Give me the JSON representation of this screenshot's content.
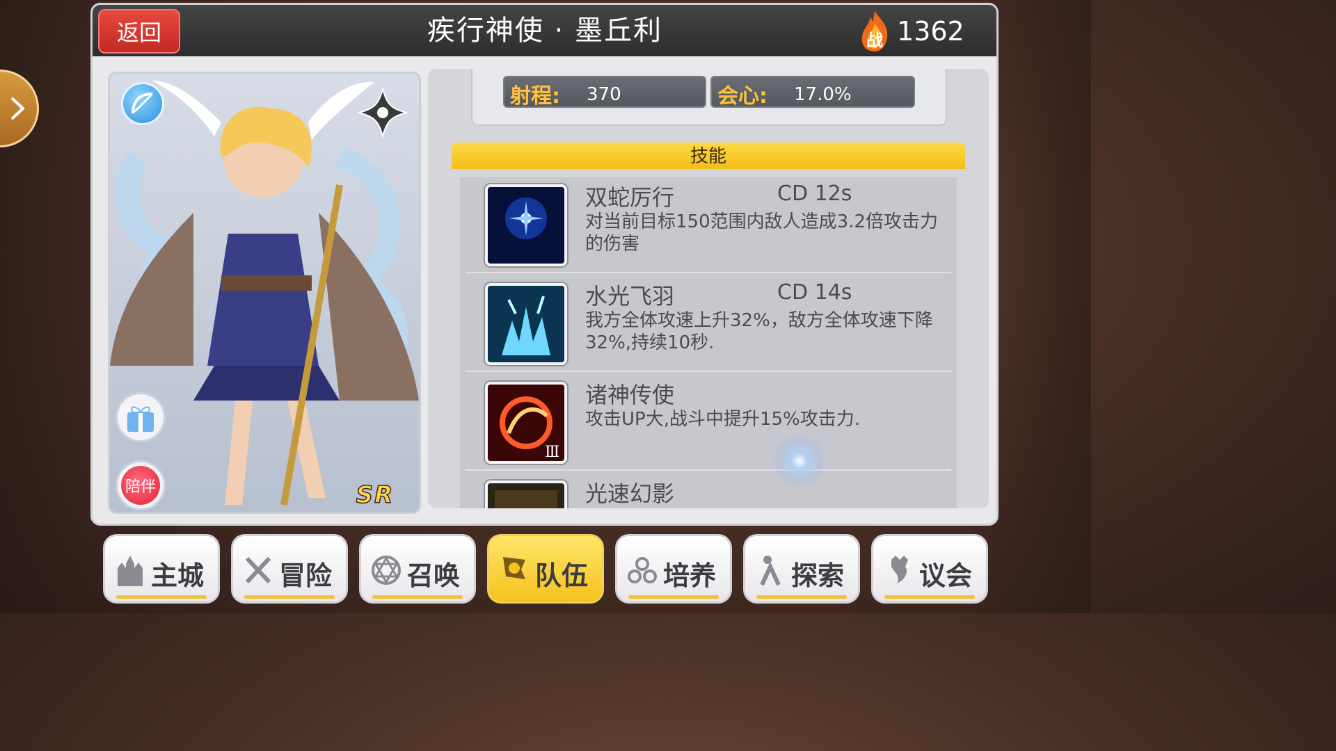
{
  "header": {
    "back_label": "返回",
    "title": "疾行神使 · 墨丘利",
    "power_badge": "战",
    "power_value": "1362"
  },
  "card": {
    "rarity": "SR",
    "companion_label": "陪伴"
  },
  "stats": [
    {
      "label": "射程:",
      "value": "370"
    },
    {
      "label": "会心:",
      "value": "17.0%"
    }
  ],
  "skills_title": "技能",
  "skills": [
    {
      "name": "双蛇厉行",
      "cd": "CD  12s",
      "desc": "对当前目标150范围内敌人造成3.2倍攻击力的伤害"
    },
    {
      "name": "水光飞羽",
      "cd": "CD  14s",
      "desc": "我方全体攻速上升32%，敌方全体攻速下降32%,持续10秒."
    },
    {
      "name": "诸神传使",
      "cd": "",
      "desc": "攻击UP大,战斗中提升15%攻击力."
    },
    {
      "name": "光速幻影",
      "cd": "",
      "desc": ""
    }
  ],
  "nav": [
    {
      "label": "主城",
      "icon": "castle-icon",
      "active": false
    },
    {
      "label": "冒险",
      "icon": "crossed-swords-icon",
      "active": false
    },
    {
      "label": "召唤",
      "icon": "hexagram-icon",
      "active": false
    },
    {
      "label": "队伍",
      "icon": "team-flag-icon",
      "active": true
    },
    {
      "label": "培养",
      "icon": "orbs-icon",
      "active": false
    },
    {
      "label": "探索",
      "icon": "explore-icon",
      "active": false
    },
    {
      "label": "议会",
      "icon": "council-icon",
      "active": false
    }
  ],
  "colors": {
    "accent": "#f6c21c",
    "back_red": "#d8382f",
    "header": "#3a3a3a"
  }
}
